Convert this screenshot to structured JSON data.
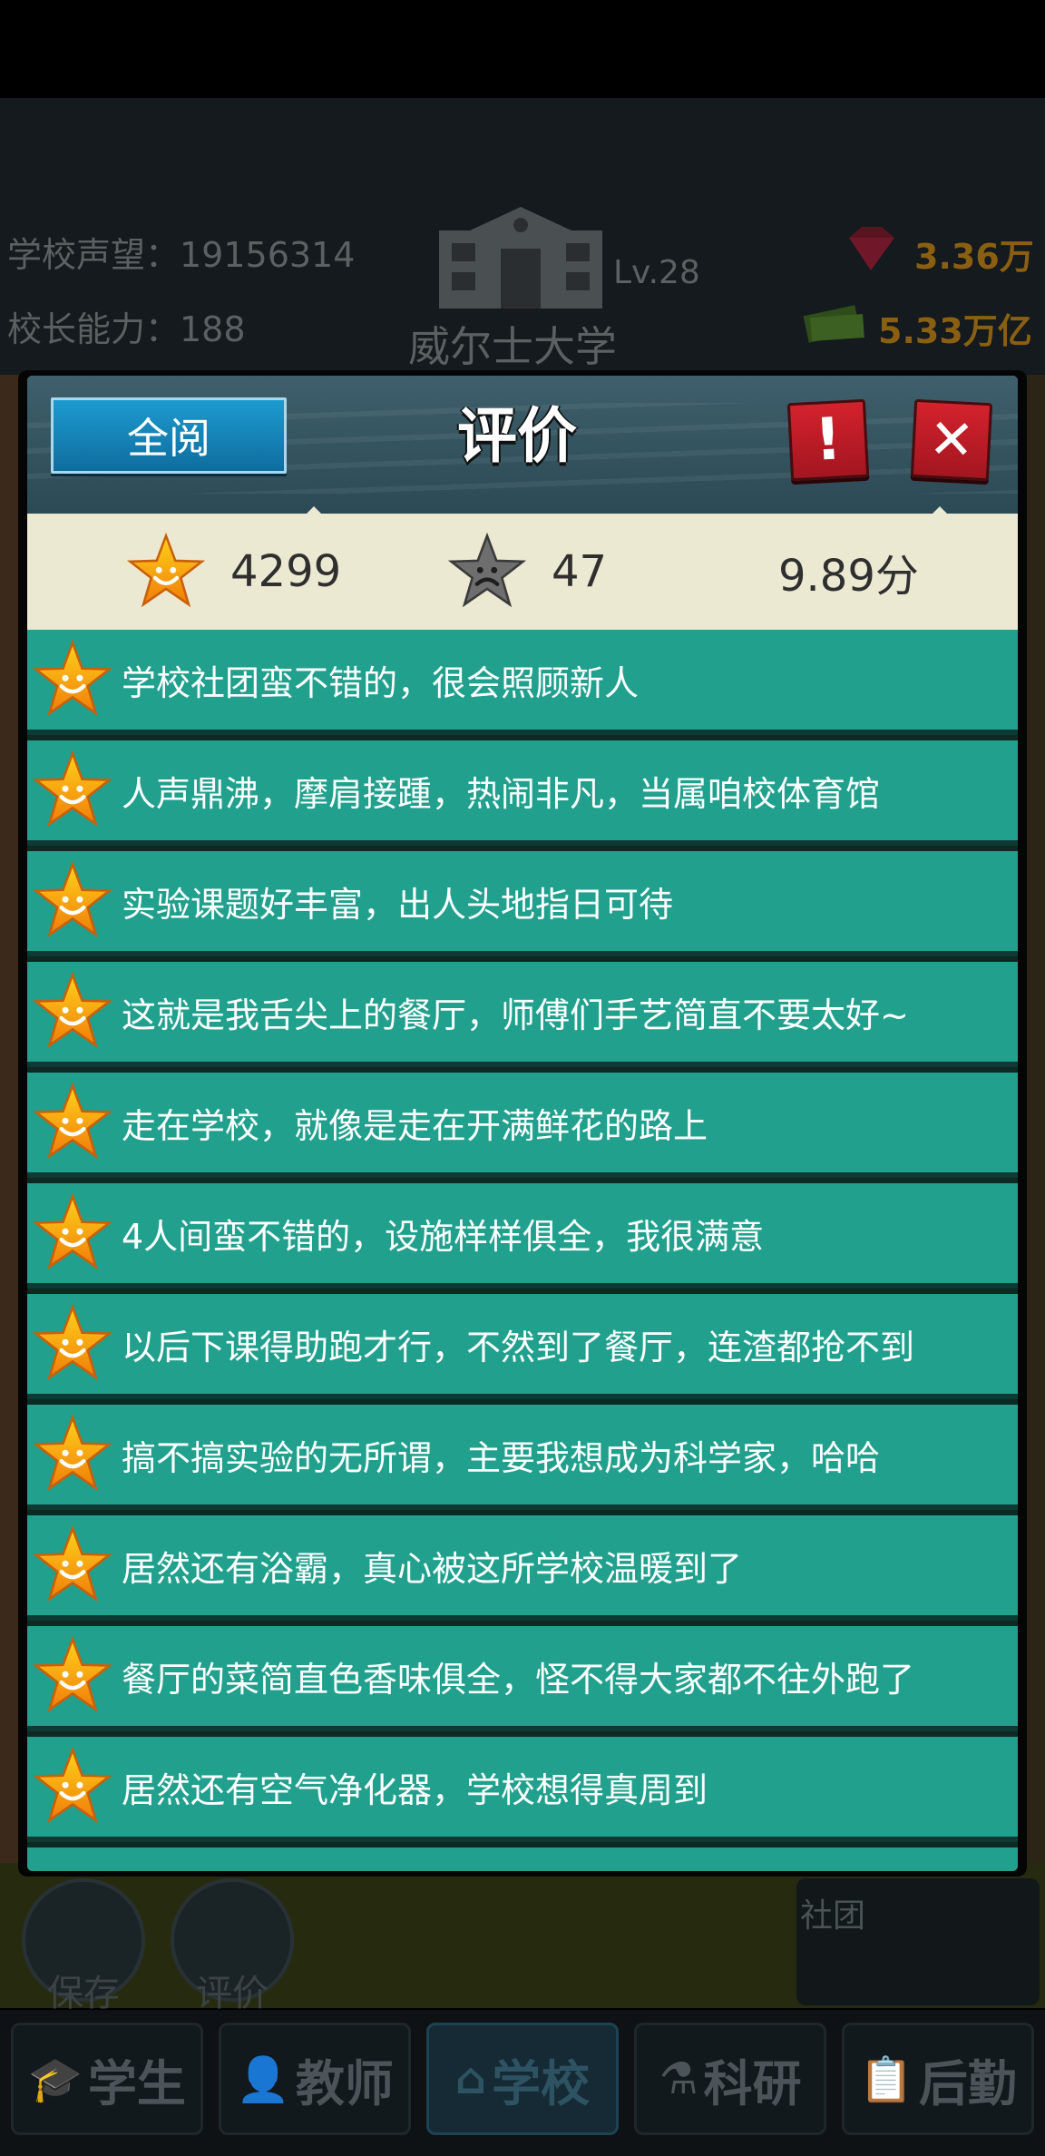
{
  "header": {
    "reputation_label": "学校声望：19156314",
    "principal_label": "校长能力：188",
    "school_name": "威尔士大学",
    "level": "Lv.28",
    "gems": "3.36万",
    "money": "5.33万亿"
  },
  "dialog": {
    "read_all_label": "全阅",
    "title": "评价",
    "alert_label": "!",
    "close_label": "✕",
    "good_count": "4299",
    "bad_count": "47",
    "score": "9.89分"
  },
  "reviews": [
    "学校社团蛮不错的，很会照顾新人",
    "人声鼎沸，摩肩接踵，热闹非凡，当属咱校体育馆",
    "实验课题好丰富，出人头地指日可待",
    "这就是我舌尖上的餐厅，师傅们手艺简直不要太好~",
    "走在学校，就像是走在开满鲜花的路上",
    "4人间蛮不错的，设施样样俱全，我很满意",
    "以后下课得助跑才行，不然到了餐厅，连渣都抢不到",
    "搞不搞实验的无所谓，主要我想成为科学家，哈哈",
    "居然还有浴霸，真心被这所学校温暖到了",
    "餐厅的菜简直色香味俱全，怪不得大家都不往外跑了",
    "居然还有空气净化器，学校想得真周到"
  ],
  "floating": {
    "save_label": "保存",
    "review_label": "评价",
    "club_label": "社团"
  },
  "nav": {
    "students": "学生",
    "teachers": "教师",
    "school": "学校",
    "research": "科研",
    "logistics": "后勤"
  },
  "colors": {
    "row_bg": "#20a08d",
    "close_red": "#c81d27",
    "read_all_blue": "#1386bb",
    "summary_bg": "#ece9d2"
  }
}
